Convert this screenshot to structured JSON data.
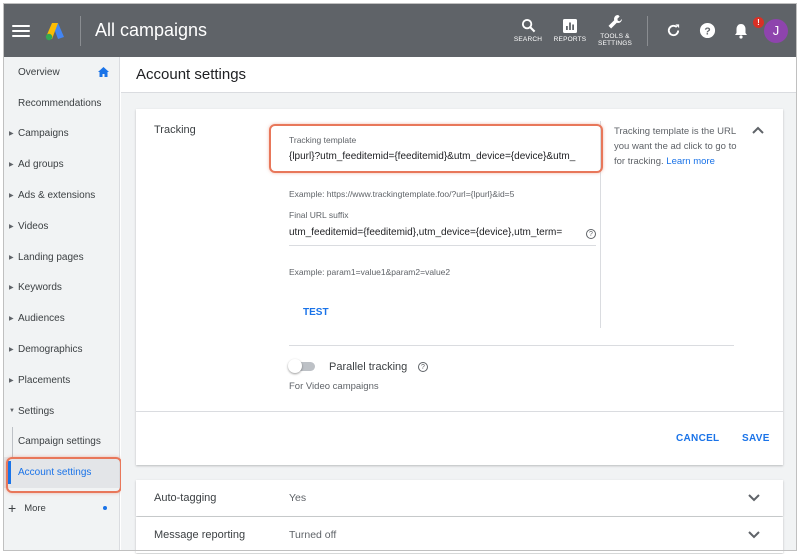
{
  "header": {
    "title": "All campaigns",
    "tools": [
      {
        "label": "SEARCH",
        "icon": "search-icon"
      },
      {
        "label": "REPORTS",
        "icon": "reports-icon"
      },
      {
        "label": "TOOLS &\nSETTINGS",
        "icon": "wrench-icon"
      }
    ],
    "notification_badge": "!",
    "avatar_initial": "J"
  },
  "sidebar": {
    "items": [
      {
        "label": "Overview",
        "has_arrow": false
      },
      {
        "label": "Recommendations",
        "has_arrow": false
      },
      {
        "label": "Campaigns",
        "has_arrow": true
      },
      {
        "label": "Ad groups",
        "has_arrow": true
      },
      {
        "label": "Ads & extensions",
        "has_arrow": true
      },
      {
        "label": "Videos",
        "has_arrow": true
      },
      {
        "label": "Landing pages",
        "has_arrow": true
      },
      {
        "label": "Keywords",
        "has_arrow": true
      },
      {
        "label": "Audiences",
        "has_arrow": true
      },
      {
        "label": "Demographics",
        "has_arrow": true
      },
      {
        "label": "Placements",
        "has_arrow": true
      },
      {
        "label": "Settings",
        "has_arrow": true,
        "expanded": true
      }
    ],
    "settings_children": [
      {
        "label": "Campaign settings"
      },
      {
        "label": "Account settings",
        "active": true
      }
    ],
    "more_label": "More"
  },
  "main": {
    "page_title": "Account settings",
    "tracking": {
      "section_label": "Tracking",
      "template_label": "Tracking template",
      "template_value": "{lpurl}?utm_feeditemid={feeditemid}&utm_device={device}&utm_",
      "template_example": "Example: https://www.trackingtemplate.foo/?url={lpurl}&id=5",
      "suffix_label": "Final URL suffix",
      "suffix_value": "utm_feeditemid={feeditemid},utm_device={device},utm_term=",
      "suffix_example": "Example: param1=value1&param2=value2",
      "test_label": "TEST",
      "help_text": "Tracking template is the URL you want the ad click to go to for tracking.",
      "help_link": "Learn more",
      "parallel_label": "Parallel tracking",
      "parallel_note": "For Video campaigns",
      "cancel_label": "CANCEL",
      "save_label": "SAVE"
    },
    "auto_tagging": {
      "label": "Auto-tagging",
      "value": "Yes"
    },
    "message_reporting": {
      "label": "Message reporting",
      "value": "Turned off"
    }
  },
  "colors": {
    "topbar": "#5f6368",
    "accent": "#1a73e8",
    "highlight": "#e8775a",
    "avatar": "#8e44ad"
  }
}
